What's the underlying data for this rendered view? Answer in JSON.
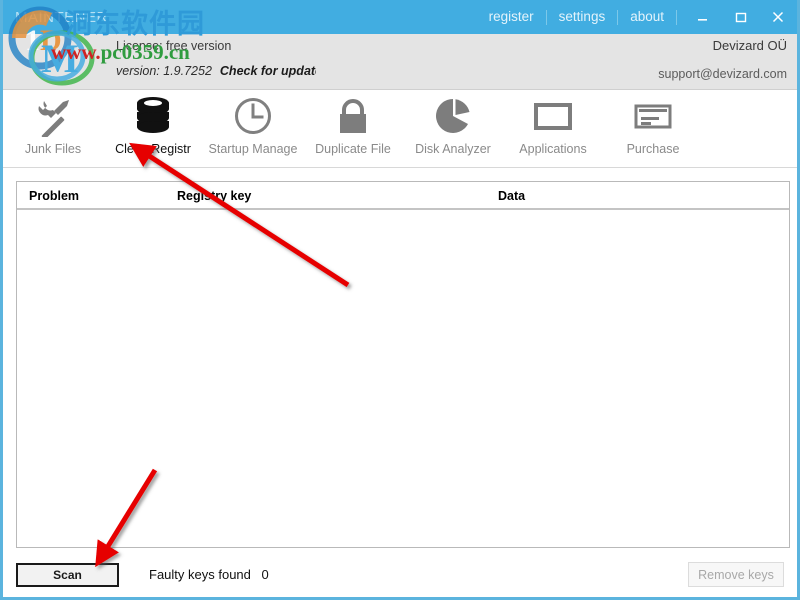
{
  "window": {
    "app_title": "MAINTENER",
    "accent_color": "#41ade1",
    "border_color": "#5bb4de"
  },
  "titlebar": {
    "menu": [
      {
        "label": "register",
        "name": "register"
      },
      {
        "label": "settings",
        "name": "settings"
      },
      {
        "label": "about",
        "name": "about"
      }
    ],
    "minimize_icon": "minimize-icon",
    "maximize_icon": "maximize-icon",
    "close_icon": "close-icon"
  },
  "infobar": {
    "license": "License: free version",
    "version": "version: 1.9.7252",
    "check_update": "Check for update",
    "company": "Devizard OÜ",
    "support": "support@devizard.com"
  },
  "toolbar": {
    "items": [
      {
        "label": "Junk Files",
        "icon": "tools-icon",
        "active": false
      },
      {
        "label": "Clean Registr",
        "icon": "database-icon",
        "active": true
      },
      {
        "label": "Startup Manage",
        "icon": "clock-icon",
        "active": false
      },
      {
        "label": "Duplicate File",
        "icon": "lock-icon",
        "active": false
      },
      {
        "label": "Disk Analyzer",
        "icon": "pie-chart-icon",
        "active": false
      },
      {
        "label": "Applications",
        "icon": "window-icon",
        "active": false
      },
      {
        "label": "Purchase",
        "icon": "credit-card-icon",
        "active": false
      }
    ]
  },
  "list": {
    "columns": [
      "Problem",
      "Registry key",
      "Data"
    ],
    "rows": []
  },
  "bottombar": {
    "scan_label": "Scan",
    "faulty_label": "Faulty keys found",
    "faulty_count": "0",
    "remove_label": "Remove keys",
    "remove_disabled": true
  },
  "watermark": {
    "cn_text": "洞东软件园",
    "url_prefix": "www.",
    "url_suffix": "pc0359.cn"
  }
}
